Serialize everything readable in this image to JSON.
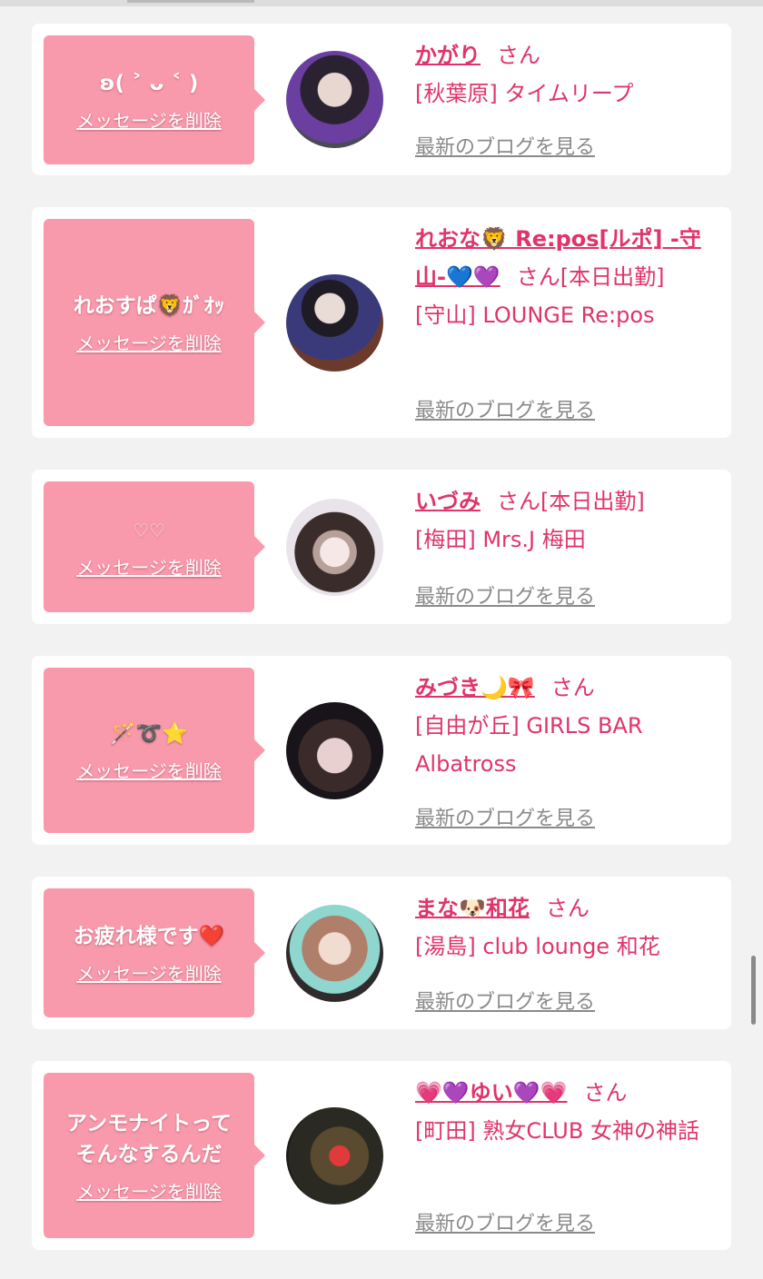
{
  "common": {
    "delete_label": "メッセージを削除",
    "blog_label": "最新のブログを見る",
    "san": "さん"
  },
  "cards": [
    {
      "message": "ʚ( ˃ ᴗ ˂ )",
      "name": "かがり",
      "suffix": "",
      "shop": "[秋葉原] タイムリープ"
    },
    {
      "message": "れおすぱ🦁ｶﾞｵｯ",
      "name": "れおな🦁 Re:pos[ルポ] -守山-💙💜",
      "suffix": "[本日出勤]",
      "shop": "[守山] LOUNGE Re:pos"
    },
    {
      "message": "♡♡",
      "name": "いづみ",
      "suffix": "[本日出勤]",
      "shop": "[梅田] Mrs.J 梅田"
    },
    {
      "message": "🪄➰⭐",
      "name": "みづき🌙🎀",
      "suffix": "",
      "shop": "[自由が丘] GIRLS BAR Albatross"
    },
    {
      "message": "お疲れ様です❤️",
      "name": "まな🐶和花",
      "suffix": "",
      "shop": "[湯島] club lounge 和花"
    },
    {
      "message": "アンモナイトって\nそんなするんだ",
      "name": "💗💜ゆい💜💗",
      "suffix": "",
      "shop": "[町田] 熟女CLUB 女神の神話"
    }
  ]
}
